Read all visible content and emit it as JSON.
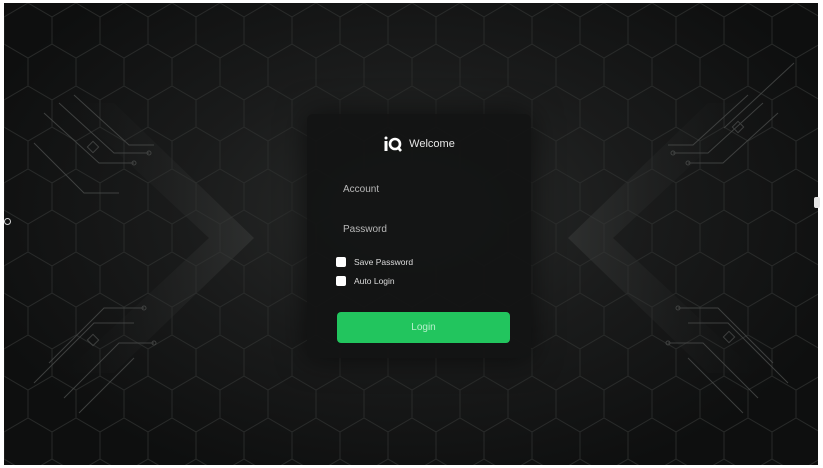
{
  "login": {
    "welcome_text": "Welcome",
    "account_placeholder": "Account",
    "password_placeholder": "Password",
    "save_password_label": "Save Password",
    "auto_login_label": "Auto Login",
    "login_button_label": "Login"
  },
  "icons": {
    "logo": "brand-logo-icon"
  },
  "colors": {
    "background": "#141515",
    "panel": "#121313",
    "accent": "#22c55e",
    "text": "#e6e6e6"
  }
}
